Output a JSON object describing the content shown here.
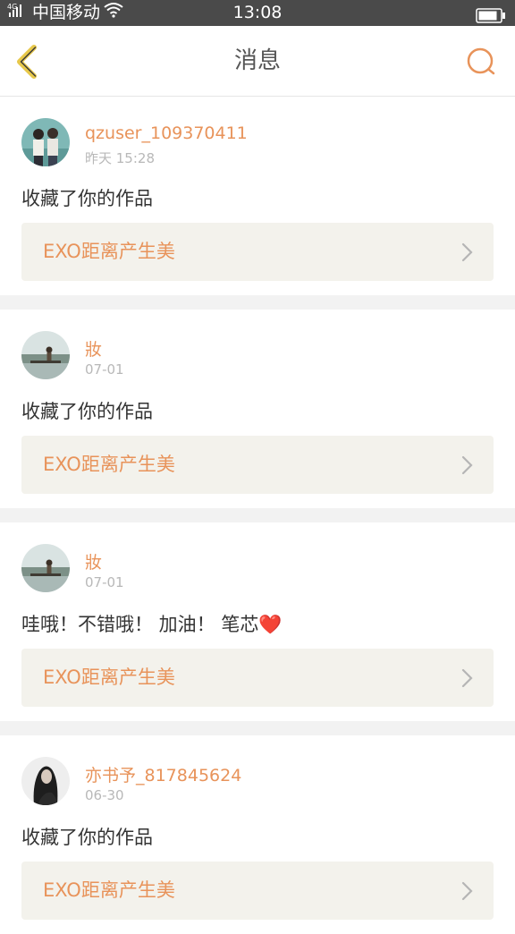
{
  "status_bar": {
    "carrier": "中国移动",
    "signal_label": "4G",
    "time": "13:08"
  },
  "header": {
    "title": "消息"
  },
  "colors": {
    "accent": "#e8935a",
    "back_arrow": "#e7c84a",
    "status_bg": "#4a4a4a"
  },
  "messages": [
    {
      "username": "qzuser_109370411",
      "time": "昨天 15:28",
      "content": "收藏了你的作品",
      "work_title": "EXO距离产生美",
      "avatar": "couple-photo-avatar"
    },
    {
      "username": "妝",
      "time": "07-01",
      "content": "收藏了你的作品",
      "work_title": "EXO距离产生美",
      "avatar": "lake-photo-avatar"
    },
    {
      "username": "妝",
      "time": "07-01",
      "content": "哇哦！不错哦！ 加油！ 笔芯❤️",
      "work_title": "EXO距离产生美",
      "avatar": "lake-photo-avatar"
    },
    {
      "username": "亦书予_817845624",
      "time": "06-30",
      "content": "收藏了你的作品",
      "work_title": "EXO距离产生美",
      "avatar": "dark-portrait-avatar"
    }
  ]
}
